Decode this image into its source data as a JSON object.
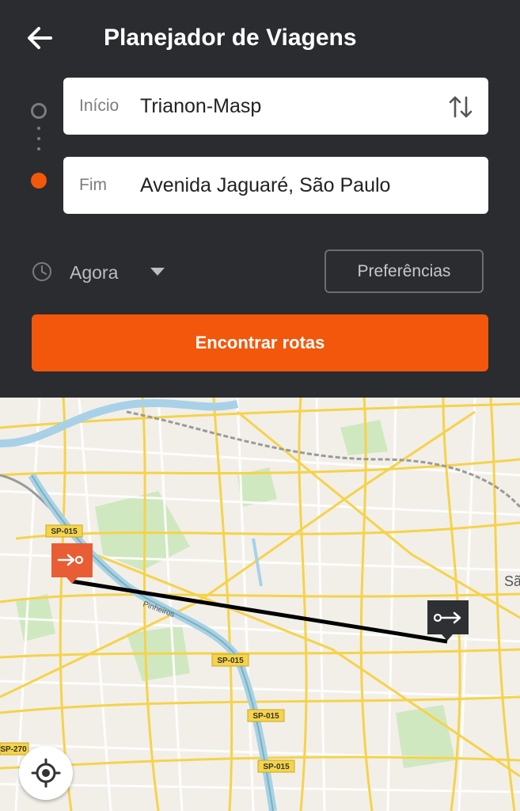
{
  "header": {
    "title": "Planejador de Viagens",
    "back_icon": "arrow-left-icon"
  },
  "route": {
    "start": {
      "label": "Início",
      "value": "Trianon-Masp"
    },
    "end": {
      "label": "Fim",
      "value": "Avenida Jaguaré, São Paulo"
    },
    "swap_icon": "swap-vertical-icon"
  },
  "options": {
    "time_value": "Agora",
    "preferences_label": "Preferências"
  },
  "actions": {
    "find_routes_label": "Encontrar rotas"
  },
  "map": {
    "road_labels": [
      "SP-015",
      "SP-015",
      "SP-015",
      "SP-015",
      "SP-270"
    ],
    "place_label": "Sã",
    "street_label": "Pinheiros"
  },
  "colors": {
    "accent": "#f2570b",
    "header_bg": "#2a2c30",
    "map_bg": "#f2efe9",
    "road": "#f5d34a"
  }
}
